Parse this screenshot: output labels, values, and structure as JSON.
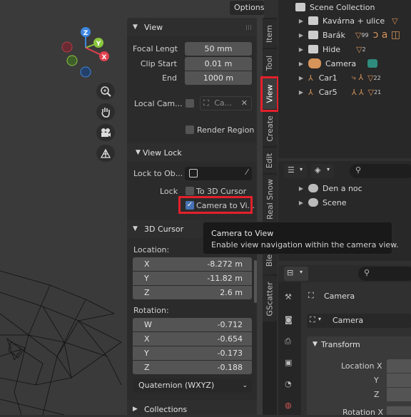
{
  "viewport": {
    "options_label": "Options",
    "gizmo_axes": {
      "x": "X",
      "y": "Y",
      "z": "Z"
    },
    "nav_icons": [
      "zoom-icon",
      "pan-hand-icon",
      "camera-view-icon",
      "ortho-grid-icon"
    ]
  },
  "view_panel": {
    "title": "View",
    "focal_length_label": "Focal Lengt",
    "focal_length_value": "50 mm",
    "clip_start_label": "Clip Start",
    "clip_start_value": "0.01 m",
    "end_label": "End",
    "end_value": "1000 m",
    "local_camera_label": "Local Cam...",
    "local_camera_value": "Ca...",
    "render_region_label": "Render Region",
    "view_lock_title": "View Lock",
    "lock_to_object_label": "Lock to Ob...",
    "lock_label": "Lock",
    "to_3d_cursor_label": "To 3D Cursor",
    "camera_to_view_label": "Camera to Vi..."
  },
  "cursor_panel": {
    "title": "3D Cursor",
    "location_label": "Location:",
    "location": [
      {
        "axis": "X",
        "value": "-8.272 m"
      },
      {
        "axis": "Y",
        "value": "-11.82 m"
      },
      {
        "axis": "Z",
        "value": "2.6 m"
      }
    ],
    "rotation_label": "Rotation:",
    "rotation": [
      {
        "axis": "W",
        "value": "-0.712"
      },
      {
        "axis": "X",
        "value": "-0.654"
      },
      {
        "axis": "Y",
        "value": "-0.173"
      },
      {
        "axis": "Z",
        "value": "-0.188"
      }
    ],
    "rotation_mode": "Quaternion (WXYZ)"
  },
  "collections_panel": {
    "title": "Collections"
  },
  "tabs": [
    "Item",
    "Tool",
    "View",
    "Create",
    "Edit",
    "Real Snow",
    "Ble",
    "GScatter"
  ],
  "active_tab": "View",
  "tooltip": {
    "title": "Camera to View",
    "description": "Enable view navigation within the camera view."
  },
  "outliner": {
    "root": "Scene Collection",
    "items": [
      {
        "name": "Kavárna + ulice",
        "badge": "99"
      },
      {
        "name": "Barák",
        "badge": "99"
      },
      {
        "name": "Hide",
        "badge": "2"
      },
      {
        "name": "Camera",
        "badge": ""
      },
      {
        "name": "Car1",
        "badge": "22"
      },
      {
        "name": "Car5",
        "badge": "21"
      }
    ]
  },
  "scenes": {
    "items": [
      {
        "name": "Den a noc"
      },
      {
        "name": "Scene"
      }
    ]
  },
  "properties": {
    "object_name": "Camera",
    "data_name": "Camera",
    "transform_title": "Transform",
    "location_x_label": "Location X",
    "y_label": "Y",
    "z_label": "Z",
    "rotation_x_label": "Rotation X"
  },
  "colors": {
    "accent": "#4772b3",
    "highlight": "#e3202b",
    "axis_x": "#e0414f",
    "axis_y": "#8bc63f",
    "axis_z": "#3d87e0",
    "object_orange": "#d7945a"
  }
}
